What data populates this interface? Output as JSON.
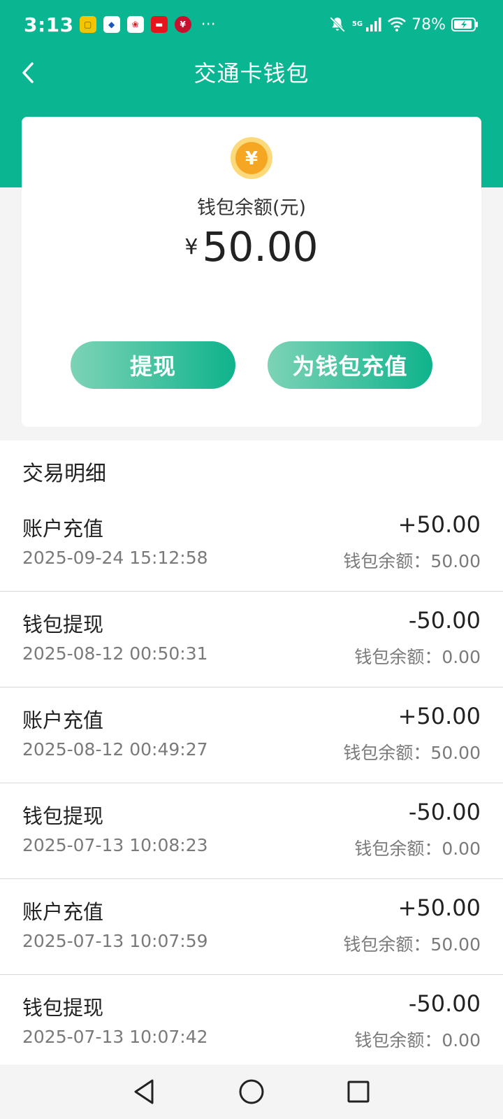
{
  "status_bar": {
    "time": "3:13",
    "more": "···",
    "signal_5g": "5G",
    "battery_percent": "78%"
  },
  "header": {
    "title": "交通卡钱包"
  },
  "balance_card": {
    "label": "钱包余额(元)",
    "currency_symbol": "¥",
    "amount": "50.00",
    "withdraw_label": "提现",
    "recharge_label": "为钱包充值"
  },
  "transactions": {
    "title": "交易明细",
    "items": [
      {
        "name": "账户充值",
        "time": "2025-09-24 15:12:58",
        "amount": "+50.00",
        "balance": "钱包余额：50.00"
      },
      {
        "name": "钱包提现",
        "time": "2025-08-12 00:50:31",
        "amount": "-50.00",
        "balance": "钱包余额：0.00"
      },
      {
        "name": "账户充值",
        "time": "2025-08-12 00:49:27",
        "amount": "+50.00",
        "balance": "钱包余额：50.00"
      },
      {
        "name": "钱包提现",
        "time": "2025-07-13 10:08:23",
        "amount": "-50.00",
        "balance": "钱包余额：0.00"
      },
      {
        "name": "账户充值",
        "time": "2025-07-13 10:07:59",
        "amount": "+50.00",
        "balance": "钱包余额：50.00"
      },
      {
        "name": "钱包提现",
        "time": "2025-07-13 10:07:42",
        "amount": "-50.00",
        "balance": "钱包余额：0.00"
      }
    ]
  },
  "colors": {
    "accent": "#0ab592",
    "coin": "#f5a623"
  }
}
